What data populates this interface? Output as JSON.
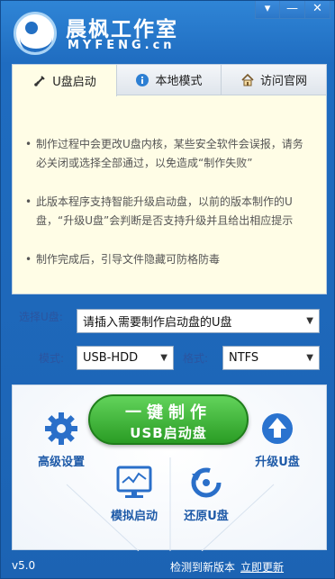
{
  "header": {
    "brand_name": "晨枫工作室",
    "brand_url": "MYFENG.cn",
    "window_buttons": [
      "▾",
      "—",
      "✕"
    ]
  },
  "tabs": [
    {
      "label": "U盘启动",
      "icon": "usb-icon",
      "active": true
    },
    {
      "label": "本地模式",
      "icon": "info-icon",
      "active": false
    },
    {
      "label": "访问官网",
      "icon": "home-icon",
      "active": false
    }
  ],
  "notes": [
    "制作过程中会更改U盘内核，某些安全软件会误报，请务必关闭或选择全部通过，以免造成“制作失败”",
    "此版本程序支持智能升级启动盘，以前的版本制作的U盘，“升级U盘”会判断是否支持升级并且给出相应提示",
    "制作完成后，引导文件隐藏可防格防毒"
  ],
  "form": {
    "udisk_label": "选择U盘:",
    "udisk_value": "请插入需要制作启动盘的U盘",
    "mode_label": "模式:",
    "mode_value": "USB-HDD",
    "format_label": "格式:",
    "format_value": "NTFS"
  },
  "actions": {
    "make_line1": "一键制作",
    "make_line2": "USB启动盘",
    "advanced": "高级设置",
    "upgrade": "升级U盘",
    "simulate": "模拟启动",
    "restore": "还原U盘"
  },
  "status": {
    "version": "v5.0",
    "update_text": "检测到新版本",
    "update_link": "立即更新"
  },
  "colors": {
    "window_blue": "#1f6cc0",
    "green_button": "#2a9c24",
    "accent_text": "#1e5aa8",
    "notes_bg": "#fffde6"
  }
}
